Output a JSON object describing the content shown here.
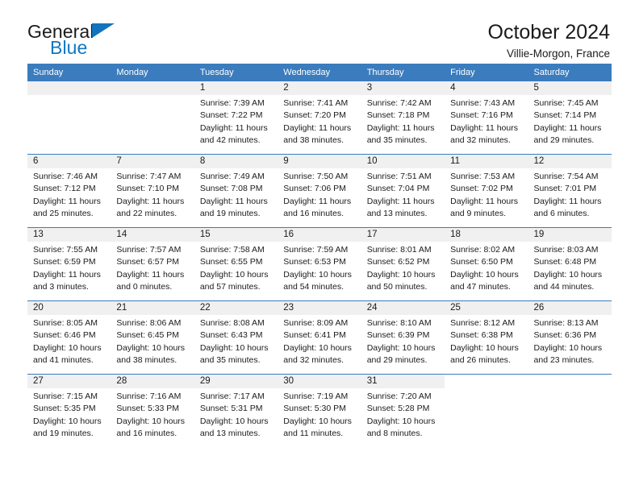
{
  "brand": {
    "word1": "General",
    "word2": "Blue",
    "logo_icon": "triangle-logo-icon",
    "accent_color": "#1077c3"
  },
  "header": {
    "title": "October 2024",
    "subtitle": "Villie-Morgon, France"
  },
  "calendar": {
    "header_bg": "#3a7cbe",
    "daynum_bg": "#f0f0f0",
    "weekday_headers": [
      "Sunday",
      "Monday",
      "Tuesday",
      "Wednesday",
      "Thursday",
      "Friday",
      "Saturday"
    ],
    "weeks": [
      [
        {
          "day": "",
          "lines": []
        },
        {
          "day": "",
          "lines": []
        },
        {
          "day": "1",
          "lines": [
            "Sunrise: 7:39 AM",
            "Sunset: 7:22 PM",
            "Daylight: 11 hours",
            "and 42 minutes."
          ]
        },
        {
          "day": "2",
          "lines": [
            "Sunrise: 7:41 AM",
            "Sunset: 7:20 PM",
            "Daylight: 11 hours",
            "and 38 minutes."
          ]
        },
        {
          "day": "3",
          "lines": [
            "Sunrise: 7:42 AM",
            "Sunset: 7:18 PM",
            "Daylight: 11 hours",
            "and 35 minutes."
          ]
        },
        {
          "day": "4",
          "lines": [
            "Sunrise: 7:43 AM",
            "Sunset: 7:16 PM",
            "Daylight: 11 hours",
            "and 32 minutes."
          ]
        },
        {
          "day": "5",
          "lines": [
            "Sunrise: 7:45 AM",
            "Sunset: 7:14 PM",
            "Daylight: 11 hours",
            "and 29 minutes."
          ]
        }
      ],
      [
        {
          "day": "6",
          "lines": [
            "Sunrise: 7:46 AM",
            "Sunset: 7:12 PM",
            "Daylight: 11 hours",
            "and 25 minutes."
          ]
        },
        {
          "day": "7",
          "lines": [
            "Sunrise: 7:47 AM",
            "Sunset: 7:10 PM",
            "Daylight: 11 hours",
            "and 22 minutes."
          ]
        },
        {
          "day": "8",
          "lines": [
            "Sunrise: 7:49 AM",
            "Sunset: 7:08 PM",
            "Daylight: 11 hours",
            "and 19 minutes."
          ]
        },
        {
          "day": "9",
          "lines": [
            "Sunrise: 7:50 AM",
            "Sunset: 7:06 PM",
            "Daylight: 11 hours",
            "and 16 minutes."
          ]
        },
        {
          "day": "10",
          "lines": [
            "Sunrise: 7:51 AM",
            "Sunset: 7:04 PM",
            "Daylight: 11 hours",
            "and 13 minutes."
          ]
        },
        {
          "day": "11",
          "lines": [
            "Sunrise: 7:53 AM",
            "Sunset: 7:02 PM",
            "Daylight: 11 hours",
            "and 9 minutes."
          ]
        },
        {
          "day": "12",
          "lines": [
            "Sunrise: 7:54 AM",
            "Sunset: 7:01 PM",
            "Daylight: 11 hours",
            "and 6 minutes."
          ]
        }
      ],
      [
        {
          "day": "13",
          "lines": [
            "Sunrise: 7:55 AM",
            "Sunset: 6:59 PM",
            "Daylight: 11 hours",
            "and 3 minutes."
          ]
        },
        {
          "day": "14",
          "lines": [
            "Sunrise: 7:57 AM",
            "Sunset: 6:57 PM",
            "Daylight: 11 hours",
            "and 0 minutes."
          ]
        },
        {
          "day": "15",
          "lines": [
            "Sunrise: 7:58 AM",
            "Sunset: 6:55 PM",
            "Daylight: 10 hours",
            "and 57 minutes."
          ]
        },
        {
          "day": "16",
          "lines": [
            "Sunrise: 7:59 AM",
            "Sunset: 6:53 PM",
            "Daylight: 10 hours",
            "and 54 minutes."
          ]
        },
        {
          "day": "17",
          "lines": [
            "Sunrise: 8:01 AM",
            "Sunset: 6:52 PM",
            "Daylight: 10 hours",
            "and 50 minutes."
          ]
        },
        {
          "day": "18",
          "lines": [
            "Sunrise: 8:02 AM",
            "Sunset: 6:50 PM",
            "Daylight: 10 hours",
            "and 47 minutes."
          ]
        },
        {
          "day": "19",
          "lines": [
            "Sunrise: 8:03 AM",
            "Sunset: 6:48 PM",
            "Daylight: 10 hours",
            "and 44 minutes."
          ]
        }
      ],
      [
        {
          "day": "20",
          "lines": [
            "Sunrise: 8:05 AM",
            "Sunset: 6:46 PM",
            "Daylight: 10 hours",
            "and 41 minutes."
          ]
        },
        {
          "day": "21",
          "lines": [
            "Sunrise: 8:06 AM",
            "Sunset: 6:45 PM",
            "Daylight: 10 hours",
            "and 38 minutes."
          ]
        },
        {
          "day": "22",
          "lines": [
            "Sunrise: 8:08 AM",
            "Sunset: 6:43 PM",
            "Daylight: 10 hours",
            "and 35 minutes."
          ]
        },
        {
          "day": "23",
          "lines": [
            "Sunrise: 8:09 AM",
            "Sunset: 6:41 PM",
            "Daylight: 10 hours",
            "and 32 minutes."
          ]
        },
        {
          "day": "24",
          "lines": [
            "Sunrise: 8:10 AM",
            "Sunset: 6:39 PM",
            "Daylight: 10 hours",
            "and 29 minutes."
          ]
        },
        {
          "day": "25",
          "lines": [
            "Sunrise: 8:12 AM",
            "Sunset: 6:38 PM",
            "Daylight: 10 hours",
            "and 26 minutes."
          ]
        },
        {
          "day": "26",
          "lines": [
            "Sunrise: 8:13 AM",
            "Sunset: 6:36 PM",
            "Daylight: 10 hours",
            "and 23 minutes."
          ]
        }
      ],
      [
        {
          "day": "27",
          "lines": [
            "Sunrise: 7:15 AM",
            "Sunset: 5:35 PM",
            "Daylight: 10 hours",
            "and 19 minutes."
          ]
        },
        {
          "day": "28",
          "lines": [
            "Sunrise: 7:16 AM",
            "Sunset: 5:33 PM",
            "Daylight: 10 hours",
            "and 16 minutes."
          ]
        },
        {
          "day": "29",
          "lines": [
            "Sunrise: 7:17 AM",
            "Sunset: 5:31 PM",
            "Daylight: 10 hours",
            "and 13 minutes."
          ]
        },
        {
          "day": "30",
          "lines": [
            "Sunrise: 7:19 AM",
            "Sunset: 5:30 PM",
            "Daylight: 10 hours",
            "and 11 minutes."
          ]
        },
        {
          "day": "31",
          "lines": [
            "Sunrise: 7:20 AM",
            "Sunset: 5:28 PM",
            "Daylight: 10 hours",
            "and 8 minutes."
          ]
        },
        {
          "day": "",
          "lines": []
        },
        {
          "day": "",
          "lines": []
        }
      ]
    ]
  }
}
